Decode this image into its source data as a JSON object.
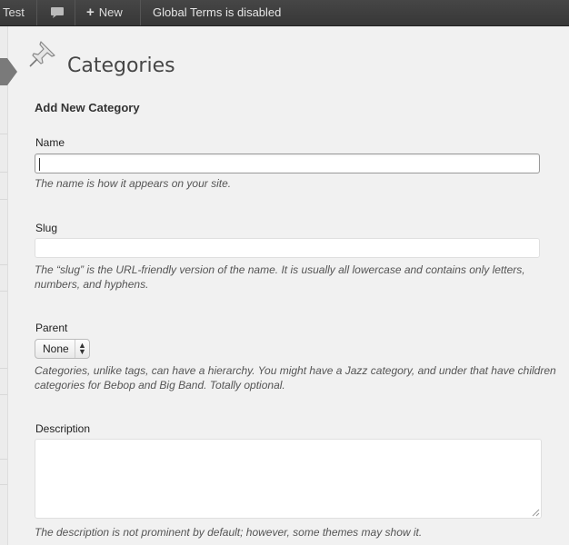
{
  "adminbar": {
    "site_name": "Test",
    "comments_icon": "speech-bubble-icon",
    "new_label": "New",
    "new_icon": "plus-icon",
    "status_text": "Global Terms is disabled"
  },
  "page": {
    "icon": "pushpin-icon",
    "title": "Categories"
  },
  "form": {
    "heading": "Add New Category",
    "name": {
      "label": "Name",
      "value": "",
      "hint": "The name is how it appears on your site."
    },
    "slug": {
      "label": "Slug",
      "value": "",
      "hint": "The “slug” is the URL-friendly version of the name. It is usually all lowercase and contains only letters, numbers, and hyphens."
    },
    "parent": {
      "label": "Parent",
      "selected": "None",
      "hint": "Categories, unlike tags, can have a hierarchy. You might have a Jazz category, and under that have children categories for Bebop and Big Band. Totally optional."
    },
    "description": {
      "label": "Description",
      "value": "",
      "hint": "The description is not prominent by default; however, some themes may show it."
    }
  },
  "colors": {
    "adminbar_bg": "#464646",
    "page_bg": "#f1f1f1",
    "hint_text": "#555555"
  }
}
